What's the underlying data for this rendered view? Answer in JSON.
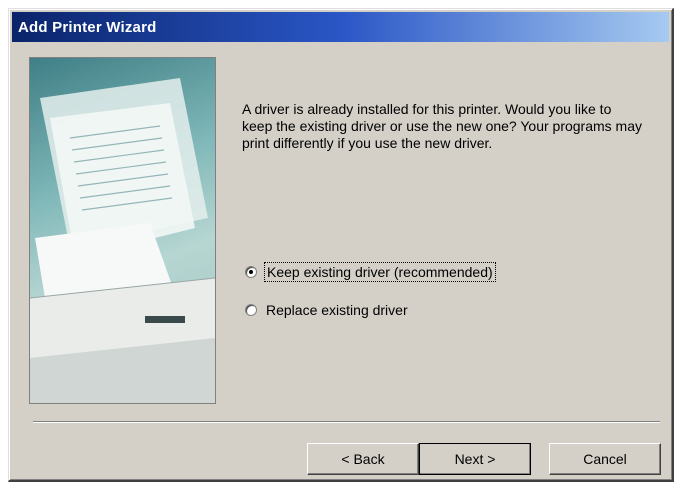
{
  "window": {
    "title": "Add Printer Wizard"
  },
  "message": "A driver is already installed for this printer. Would you like to keep the existing driver or use the new one? Your programs may print differently if you use the new driver.",
  "options": [
    {
      "label": "Keep existing driver (recommended)",
      "checked": true
    },
    {
      "label": "Replace existing driver",
      "checked": false
    }
  ],
  "buttons": {
    "back": "< Back",
    "next": "Next >",
    "cancel": "Cancel"
  },
  "colors": {
    "title_start": "#0a246a",
    "title_end": "#a6caf0",
    "face": "#d4d0c8"
  }
}
